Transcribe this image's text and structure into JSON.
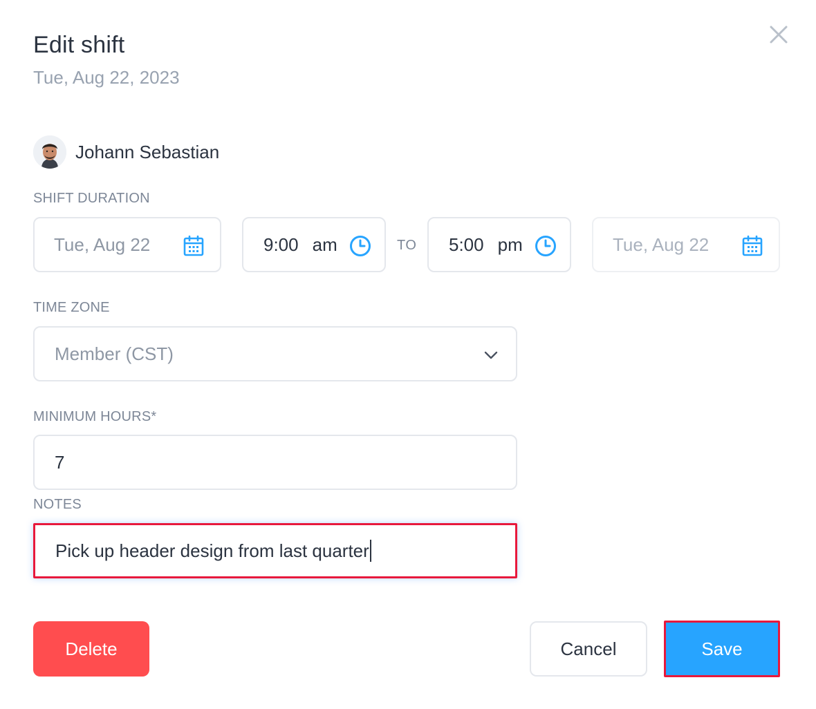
{
  "dialog": {
    "title": "Edit shift",
    "subtitle": "Tue, Aug 22, 2023"
  },
  "member": {
    "name": "Johann Sebastian"
  },
  "shift_duration": {
    "label": "SHIFT DURATION",
    "start_date": "Tue, Aug 22",
    "start_time": "9:00",
    "start_period": "am",
    "separator": "TO",
    "end_time": "5:00",
    "end_period": "pm",
    "end_date": "Tue, Aug 22"
  },
  "time_zone": {
    "label": "TIME ZONE",
    "value": "Member (CST)"
  },
  "minimum_hours": {
    "label": "MINIMUM HOURS*",
    "value": "7"
  },
  "notes": {
    "label": "NOTES",
    "value": "Pick up header design from last quarter"
  },
  "actions": {
    "delete_label": "Delete",
    "cancel_label": "Cancel",
    "save_label": "Save"
  },
  "icons": {
    "close": "close-icon",
    "calendar": "calendar-icon",
    "clock": "clock-icon",
    "chevron": "chevron-down-icon"
  },
  "colors": {
    "accent": "#27a4ff",
    "danger": "#ff4d4f",
    "highlight_border": "#e8193c",
    "label": "#7d8797"
  }
}
